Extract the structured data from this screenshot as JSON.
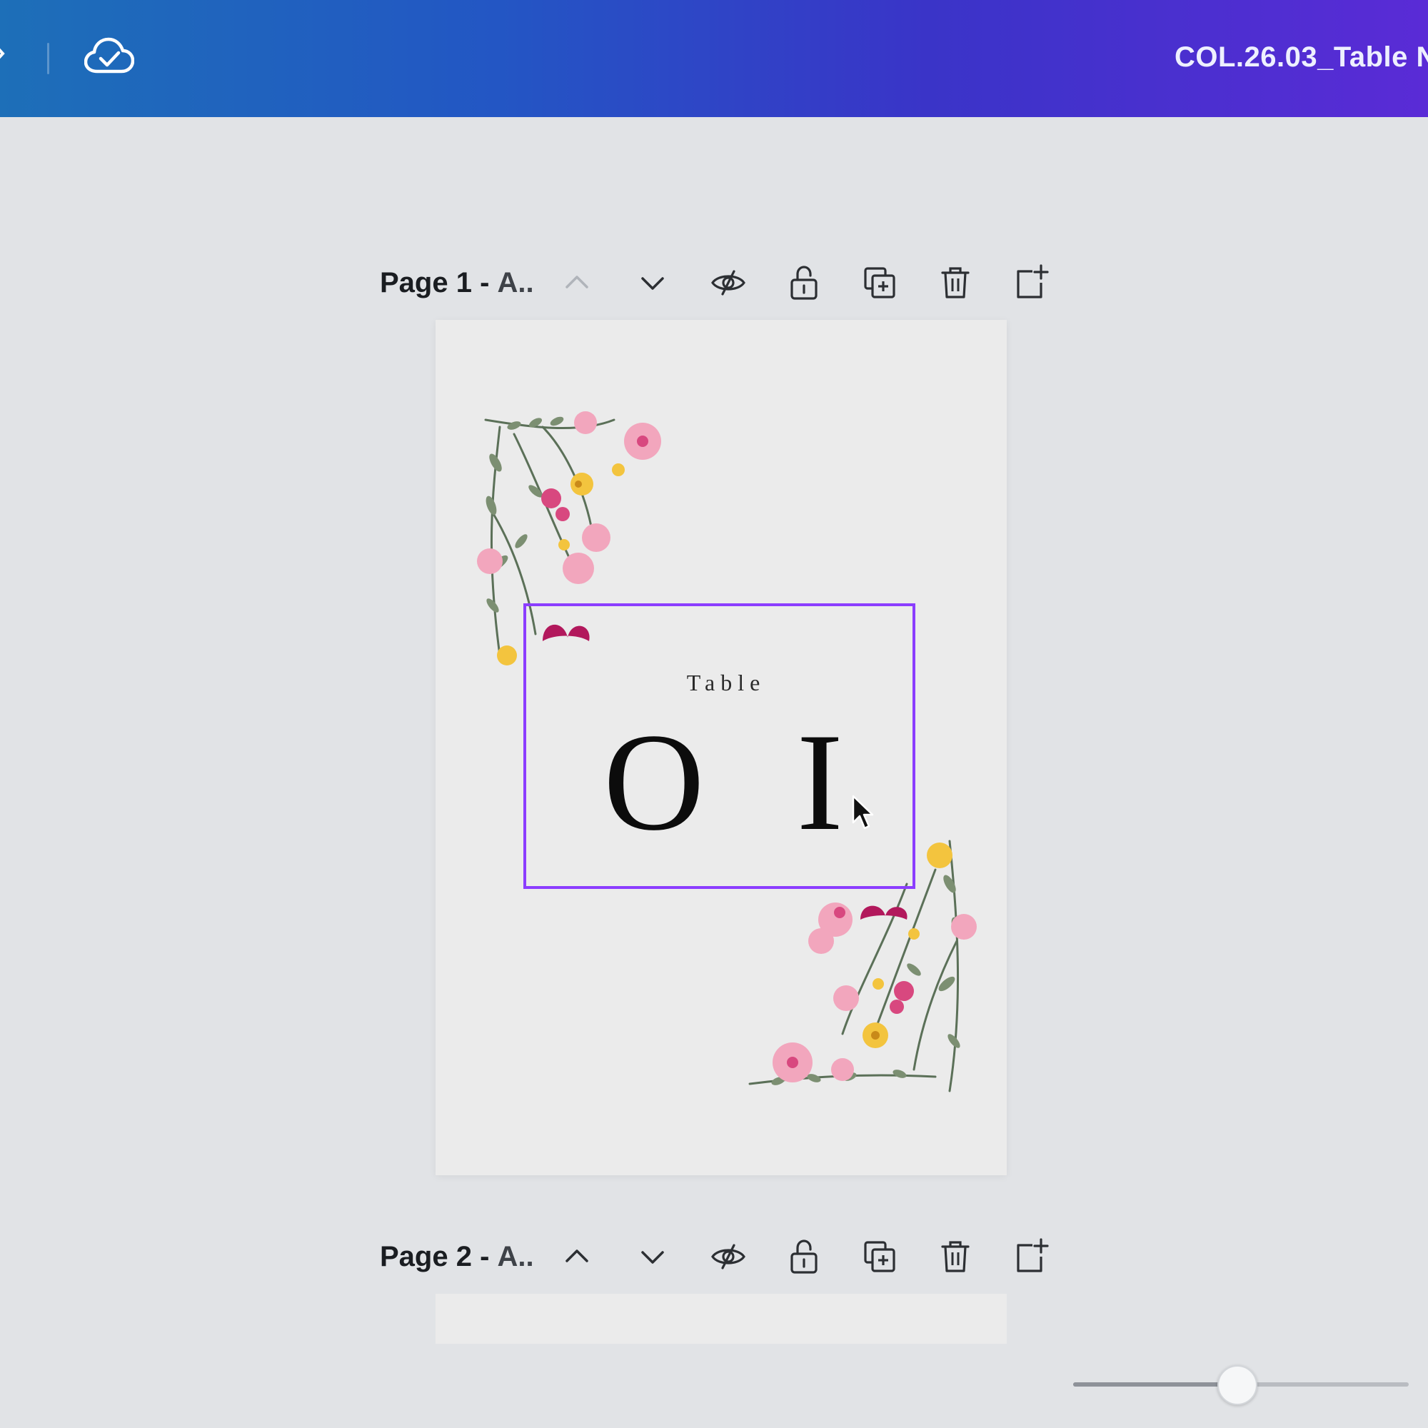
{
  "header": {
    "document_title": "COL.26.03_Table N",
    "icons": [
      "chevron-right-icon",
      "cloud-check-icon"
    ]
  },
  "pages": [
    {
      "label_bold": "Page 1 -",
      "label_sub": "A..",
      "actions": [
        "move-up",
        "move-down",
        "hide",
        "lock",
        "duplicate",
        "delete",
        "add-page"
      ]
    },
    {
      "label_bold": "Page 2 -",
      "label_sub": "A..",
      "actions": [
        "move-up",
        "move-down",
        "hide",
        "lock",
        "duplicate",
        "delete",
        "add-page"
      ]
    }
  ],
  "design": {
    "small_text": "Table",
    "number_text": "O I"
  },
  "zoom": {
    "level_fraction": 0.49
  },
  "colors": {
    "selection": "#8b3dff",
    "header_start": "#1d6fb8",
    "header_end": "#5a2bd6"
  }
}
